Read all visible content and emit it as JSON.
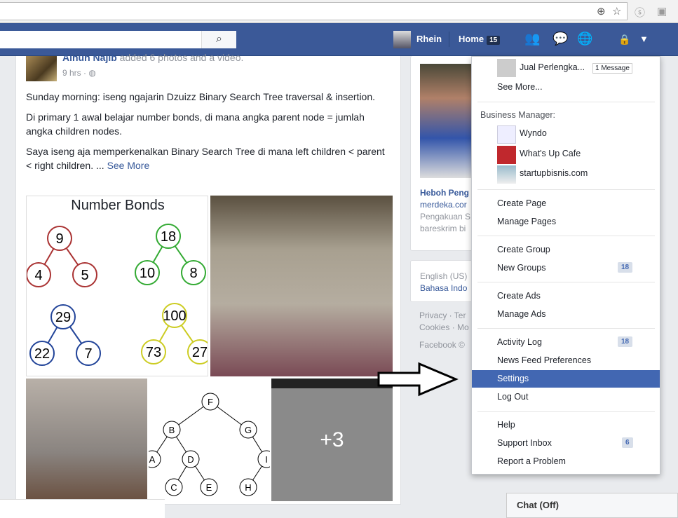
{
  "browser": {
    "icons": [
      "zoom-icon",
      "star-icon",
      "skype-icon",
      "devtools-icon"
    ]
  },
  "topbar": {
    "search_placeholder": "",
    "user": "Rhein",
    "home": "Home",
    "home_count": "15"
  },
  "post": {
    "author": "Aihun Najib",
    "action": "added 6 photos and a video.",
    "time": "9 hrs",
    "privacy_icon": "globe-icon",
    "paragraphs": [
      "Sunday morning: iseng ngajarin Dzuizz Binary Search Tree traversal & insertion.",
      "Di primary 1 awal belajar number bonds, di mana angka parent node = jumlah angka children nodes."
    ],
    "last_paragraph": "Saya iseng aja memperkenalkan Binary Search Tree di mana left children < parent < right children. ...",
    "see_more": "See More",
    "number_bonds": {
      "title": "Number Bonds",
      "bonds": [
        [
          "9",
          "4",
          "5"
        ],
        [
          "18",
          "10",
          "8"
        ],
        [
          "29",
          "22",
          "7"
        ],
        [
          "100",
          "73",
          "27"
        ]
      ]
    },
    "tree_nodes": [
      "F",
      "B",
      "G",
      "A",
      "D",
      "I",
      "C",
      "E",
      "H"
    ],
    "more_count": "+3"
  },
  "right": {
    "headline": "Heboh Peng",
    "source": "merdeka.cor",
    "desc1": "Pengakuan S",
    "desc2": "bareskrim bi",
    "lang1": "English (US)",
    "lang2": "Bahasa Indo",
    "footer1": "Privacy · Ter",
    "footer2": "Cookies · Mo",
    "footer3": "Facebook ©"
  },
  "menu": {
    "page_item": "Jual Perlengka...",
    "page_badge": "1 Message",
    "see_more": "See More...",
    "bm_header": "Business Manager:",
    "businesses": [
      "Wyndo",
      "What's Up Cafe",
      "startupbisnis.com"
    ],
    "create_page": "Create Page",
    "manage_pages": "Manage Pages",
    "create_group": "Create Group",
    "new_groups": "New Groups",
    "new_groups_count": "18",
    "create_ads": "Create Ads",
    "manage_ads": "Manage Ads",
    "activity_log": "Activity Log",
    "activity_count": "18",
    "news_feed_prefs": "News Feed Preferences",
    "settings": "Settings",
    "log_out": "Log Out",
    "help": "Help",
    "support_inbox": "Support Inbox",
    "support_count": "6",
    "report_problem": "Report a Problem"
  },
  "chat": {
    "label": "Chat (Off)"
  },
  "colors": {
    "brand": "#3b5998",
    "selected": "#4267b2"
  }
}
